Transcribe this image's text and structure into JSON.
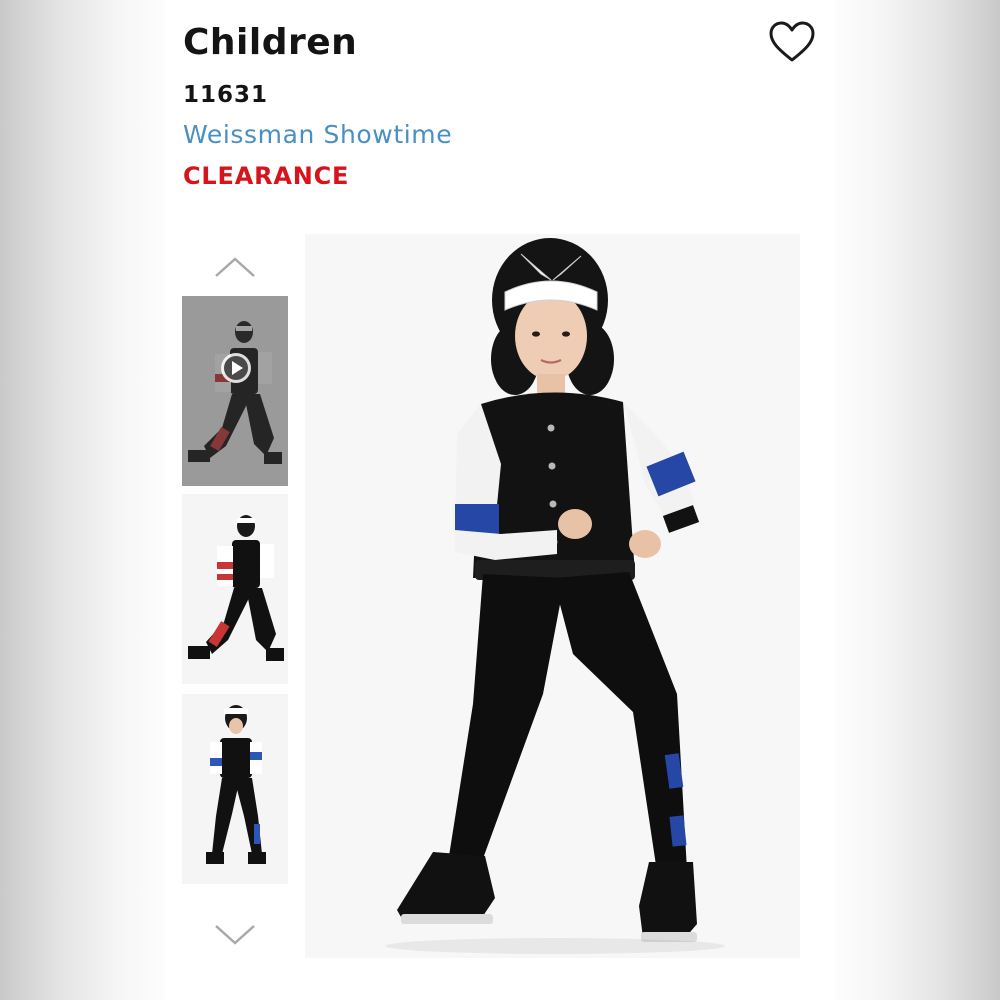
{
  "product": {
    "title": "Children",
    "sku": "11631",
    "brand": "Weissman Showtime",
    "badge": "CLEARANCE"
  },
  "icons": {
    "favorite": "heart-outline-icon",
    "up": "chevron-up-icon",
    "down": "chevron-down-icon",
    "play": "play-icon"
  },
  "gallery": {
    "thumbnails": [
      {
        "name": "video",
        "accent": "#c93434",
        "selected": true
      },
      {
        "name": "side-pose",
        "accent": "#c93434",
        "selected": false
      },
      {
        "name": "front-pose",
        "accent": "#2e55b8",
        "selected": false
      }
    ]
  },
  "colors": {
    "brand_link": "#4a8fc4",
    "clearance": "#d7131b",
    "text": "#141414"
  }
}
